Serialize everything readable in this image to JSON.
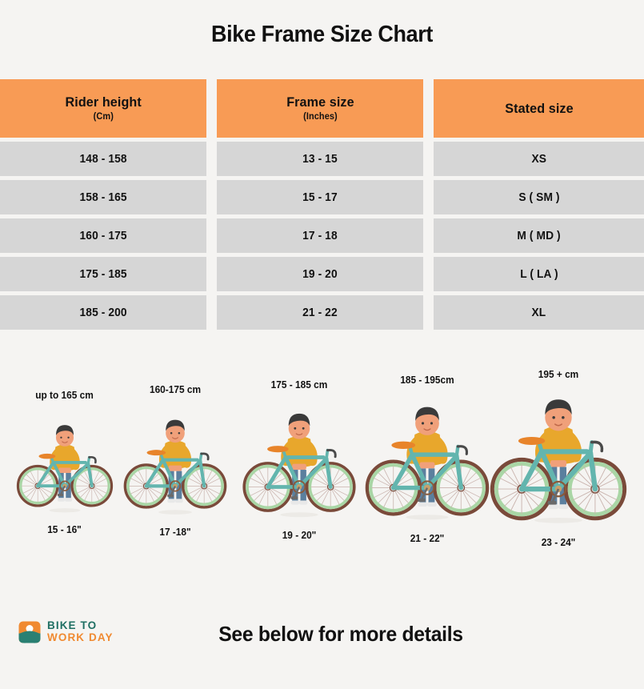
{
  "title": "Bike Frame Size Chart",
  "table": {
    "headers": [
      {
        "main": "Rider height",
        "sub": "(Cm)"
      },
      {
        "main": "Frame size",
        "sub": "(Inches)"
      },
      {
        "main": "Stated size",
        "sub": ""
      }
    ],
    "rows": [
      {
        "rider_height": "148 - 158",
        "frame_size": "13 - 15",
        "stated_size": "XS"
      },
      {
        "rider_height": "158 - 165",
        "frame_size": "15 - 17",
        "stated_size": "S ( SM )"
      },
      {
        "rider_height": "160 - 175",
        "frame_size": "17 - 18",
        "stated_size": "M ( MD )"
      },
      {
        "rider_height": "175 - 185",
        "frame_size": "19 - 20",
        "stated_size": "L ( LA )"
      },
      {
        "rider_height": "185 - 200",
        "frame_size": "21 - 22",
        "stated_size": "XL"
      }
    ]
  },
  "figures": [
    {
      "height_label": "up to 165 cm",
      "frame_label": "15 - 16\""
    },
    {
      "height_label": "160-175 cm",
      "frame_label": "17 -18\""
    },
    {
      "height_label": "175 - 185 cm",
      "frame_label": "19 - 20\""
    },
    {
      "height_label": "185 - 195cm",
      "frame_label": "21 - 22\""
    },
    {
      "height_label": "195 + cm",
      "frame_label": "23 - 24\""
    }
  ],
  "footer": {
    "logo_line1": "BIKE TO",
    "logo_line2": "WORK DAY",
    "cta": "See below for more details"
  },
  "colors": {
    "background": "#f5f4f2",
    "header_orange": "#f89b55",
    "row_gray": "#d6d6d6",
    "text_black": "#111111",
    "logo_teal": "#1f6f63",
    "logo_orange": "#f08a31",
    "bike_frame": "#63b5ae",
    "wheel_rim": "#a9d6a5",
    "tire": "#7a4a3a",
    "saddle": "#e8842a",
    "sweater": "#e8a72c",
    "jeans": "#5b7f9e",
    "hair": "#3a3a3a",
    "skin": "#f0a07a"
  }
}
